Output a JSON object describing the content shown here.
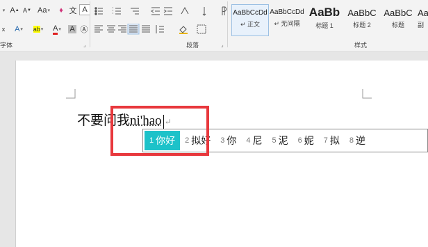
{
  "ribbon": {
    "groups": {
      "font": "字体",
      "paragraph": "段落",
      "styles": "样式"
    },
    "font_buttons": {
      "grow": "A",
      "shrink": "A",
      "case": "Aa",
      "eraser": "♦",
      "phonetic": "文",
      "charborder": "A",
      "clear": "x",
      "effects": "A",
      "highlight": "ab",
      "color": "A",
      "enclose": "Ⓐ"
    },
    "styles": [
      {
        "sample": "AaBbCcDd",
        "name": "↵ 正文"
      },
      {
        "sample": "AaBbCcDd",
        "name": "↵ 无间隔"
      },
      {
        "sample": "AaBb",
        "name": "标题 1"
      },
      {
        "sample": "AaBbC",
        "name": "标题 2"
      },
      {
        "sample": "AaBbC",
        "name": "标题"
      },
      {
        "sample": "Aa",
        "name": "副"
      }
    ]
  },
  "document": {
    "text_prefix": "不要问我",
    "composition": "ni'hao",
    "para_mark": "↵"
  },
  "ime": {
    "candidates": [
      {
        "num": "1",
        "text": "你好"
      },
      {
        "num": "2",
        "text": "拟好"
      },
      {
        "num": "3",
        "text": "你"
      },
      {
        "num": "4",
        "text": "尼"
      },
      {
        "num": "5",
        "text": "泥"
      },
      {
        "num": "6",
        "text": "妮"
      },
      {
        "num": "7",
        "text": "拟"
      },
      {
        "num": "8",
        "text": "逆"
      }
    ]
  },
  "colors": {
    "highlight_box": "#e8383d",
    "selected_candidate": "#1cc2c9"
  }
}
